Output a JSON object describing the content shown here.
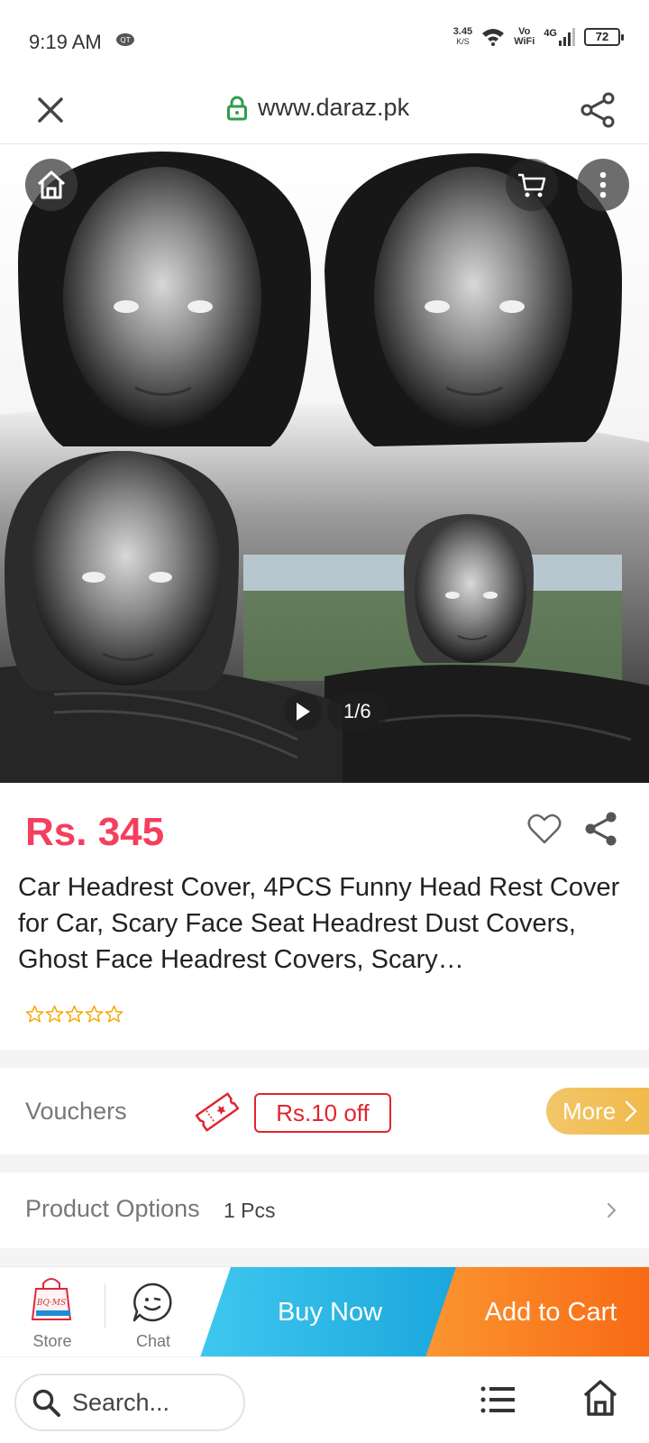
{
  "status_bar": {
    "time": "9:19 AM",
    "net_speed": "3.45",
    "net_speed_unit": "K/S",
    "volte_top": "Vo",
    "volte_bottom": "WiFi",
    "network": "4G",
    "battery": "72"
  },
  "browser": {
    "url": "www.daraz.pk",
    "search_placeholder": "Search..."
  },
  "gallery": {
    "counter": "1/6"
  },
  "product": {
    "price": "Rs. 345",
    "title": "Car Headrest Cover, 4PCS Funny Head Rest Cover for Car, Scary Face Seat Headrest Dust Covers, Ghost Face Headrest Covers, Scary…",
    "rating_stars_filled": 0,
    "rating_stars_total": 5
  },
  "vouchers": {
    "label": "Vouchers",
    "chip": "Rs.10 off",
    "more": "More"
  },
  "options": {
    "label": "Product Options",
    "value": "1 Pcs"
  },
  "action_bar": {
    "store_label": "Store",
    "chat_label": "Chat",
    "buy_now": "Buy Now",
    "add_to_cart": "Add to Cart"
  },
  "colors": {
    "price": "#f43f5e",
    "buy_now": "#1aa7dd",
    "add_to_cart": "#f86a14",
    "voucher": "#e0262f",
    "more": "#f1b949",
    "lock": "#2e9e4f"
  }
}
